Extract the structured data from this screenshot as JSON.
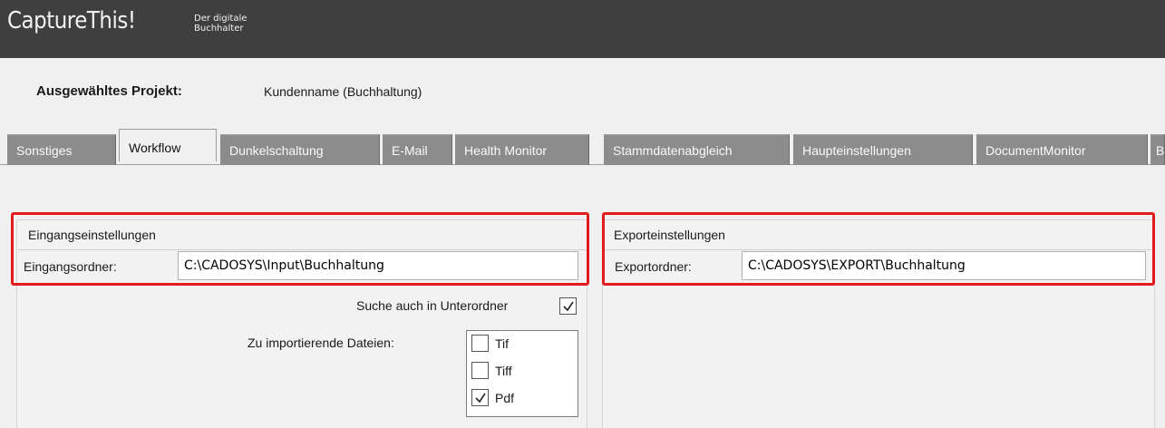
{
  "app": {
    "brand": "CaptureThis!",
    "tagline_line1": "Der digitale",
    "tagline_line2": "Buchhalter"
  },
  "project": {
    "label": "Ausgewähltes Projekt:",
    "value": "Kundenname (Buchhaltung)"
  },
  "tabs": [
    {
      "label": "Sonstiges",
      "active": false
    },
    {
      "label": "Workflow",
      "active": true
    },
    {
      "label": "Dunkelschaltung",
      "active": false
    },
    {
      "label": "E-Mail",
      "active": false
    },
    {
      "label": "Health Monitor",
      "active": false
    },
    {
      "label": "Stammdatenabgleich",
      "active": false
    },
    {
      "label": "Haupteinstellungen",
      "active": false
    },
    {
      "label": "DocumentMonitor",
      "active": false
    },
    {
      "label": "B",
      "active": false
    }
  ],
  "input_settings": {
    "title": "Eingangseinstellungen",
    "folder_label": "Eingangsordner:",
    "folder_value": "C:\\CADOSYS\\Input\\Buchhaltung",
    "subfolder_label": "Suche auch in Unterordner",
    "subfolder_checked": true,
    "filetypes_label": "Zu importierende Dateien:",
    "filetypes": [
      {
        "label": "Tif",
        "checked": false
      },
      {
        "label": "Tiff",
        "checked": false
      },
      {
        "label": "Pdf",
        "checked": true
      }
    ]
  },
  "export_settings": {
    "title": "Exporteinstellungen",
    "folder_label": "Exportordner:",
    "folder_value": "C:\\CADOSYS\\EXPORT\\Buchhaltung"
  },
  "colors": {
    "titlebar": "#3f3f3f",
    "tab_inactive": "#8c8c8c",
    "highlight": "#e11b1b"
  }
}
